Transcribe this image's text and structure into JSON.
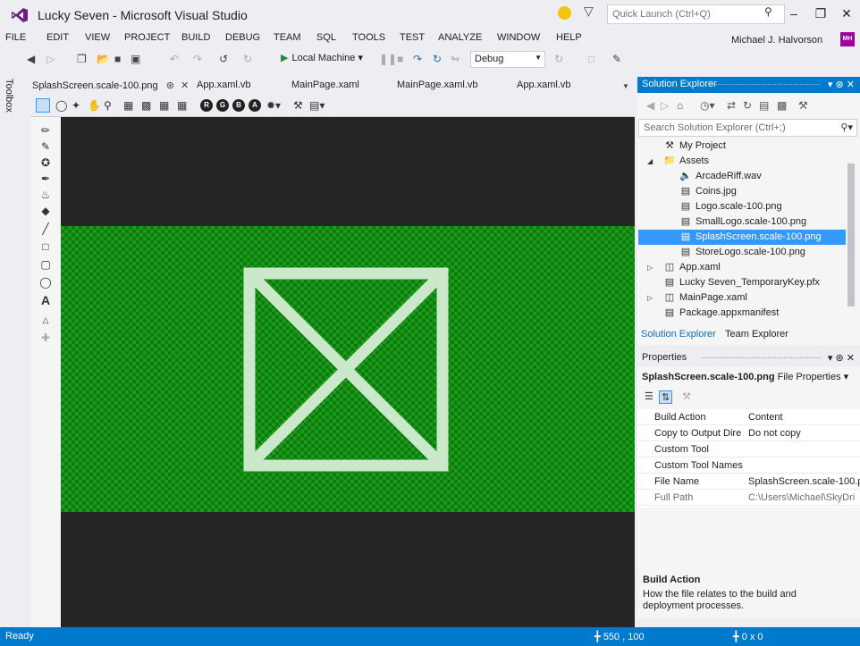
{
  "window": {
    "title": "Lucky Seven - Microsoft Visual Studio",
    "quick_launch_placeholder": "Quick Launch (Ctrl+Q)",
    "controls": {
      "minimize": "–",
      "restore": "❐",
      "close": "✕"
    }
  },
  "menu": {
    "items": [
      "FILE",
      "EDIT",
      "VIEW",
      "PROJECT",
      "BUILD",
      "DEBUG",
      "TEAM",
      "SQL",
      "TOOLS",
      "TEST",
      "ANALYZE",
      "WINDOW",
      "HELP"
    ],
    "user": "Michael J. Halvorson",
    "user_initials": "MH"
  },
  "toolbar": {
    "run_target": "Local Machine",
    "configuration": "Debug"
  },
  "toolbox": {
    "label": "Toolbox"
  },
  "doc_tabs": {
    "active": "SplashScreen.scale-100.png",
    "others": [
      "App.xaml.vb",
      "MainPage.xaml",
      "MainPage.xaml.vb",
      "App.xaml.vb"
    ]
  },
  "editor": {
    "canvas_bg": "#252526",
    "image_green": "#1A9C1A",
    "placeholder_stroke": "#CBE8CB"
  },
  "solution_explorer": {
    "title": "Solution Explorer",
    "search_placeholder": "Search Solution Explorer (Ctrl+;)",
    "items": [
      {
        "label": "My Project",
        "icon": "wrench-icon",
        "depth": 1,
        "arrow": ""
      },
      {
        "label": "Assets",
        "icon": "folder-icon",
        "depth": 0,
        "arrow": "◢"
      },
      {
        "label": "ArcadeRiff.wav",
        "icon": "speaker-icon",
        "depth": 2,
        "arrow": ""
      },
      {
        "label": "Coins.jpg",
        "icon": "image-icon",
        "depth": 2,
        "arrow": ""
      },
      {
        "label": "Logo.scale-100.png",
        "icon": "image-icon",
        "depth": 2,
        "arrow": ""
      },
      {
        "label": "SmallLogo.scale-100.png",
        "icon": "image-icon",
        "depth": 2,
        "arrow": ""
      },
      {
        "label": "SplashScreen.scale-100.png",
        "icon": "image-icon",
        "depth": 2,
        "arrow": "",
        "selected": true
      },
      {
        "label": "StoreLogo.scale-100.png",
        "icon": "image-icon",
        "depth": 2,
        "arrow": ""
      },
      {
        "label": "App.xaml",
        "icon": "xaml-icon",
        "depth": 0,
        "arrow": "▷"
      },
      {
        "label": "Lucky Seven_TemporaryKey.pfx",
        "icon": "certificate-icon",
        "depth": 1,
        "arrow": ""
      },
      {
        "label": "MainPage.xaml",
        "icon": "xaml-icon",
        "depth": 0,
        "arrow": "▷"
      },
      {
        "label": "Package.appxmanifest",
        "icon": "manifest-icon",
        "depth": 1,
        "arrow": ""
      }
    ],
    "tabs": [
      "Solution Explorer",
      "Team Explorer"
    ]
  },
  "properties": {
    "title": "Properties",
    "target_name": "SplashScreen.scale-100.png",
    "target_type": "File Properties",
    "rows": [
      {
        "name": "Build Action",
        "value": "Content",
        "dim": false
      },
      {
        "name": "Copy to Output Dire",
        "value": "Do not copy",
        "dim": false
      },
      {
        "name": "Custom Tool",
        "value": "",
        "dim": false
      },
      {
        "name": "Custom Tool Names",
        "value": "",
        "dim": false
      },
      {
        "name": "File Name",
        "value": "SplashScreen.scale-100.p",
        "dim": false
      },
      {
        "name": "Full Path",
        "value": "C:\\Users\\Michael\\SkyDri",
        "dim": true
      }
    ],
    "desc_title": "Build Action",
    "desc_text": "How the file relates to the build and deployment processes."
  },
  "status": {
    "text": "Ready",
    "position": "550 , 100",
    "selection": "0 x 0"
  }
}
